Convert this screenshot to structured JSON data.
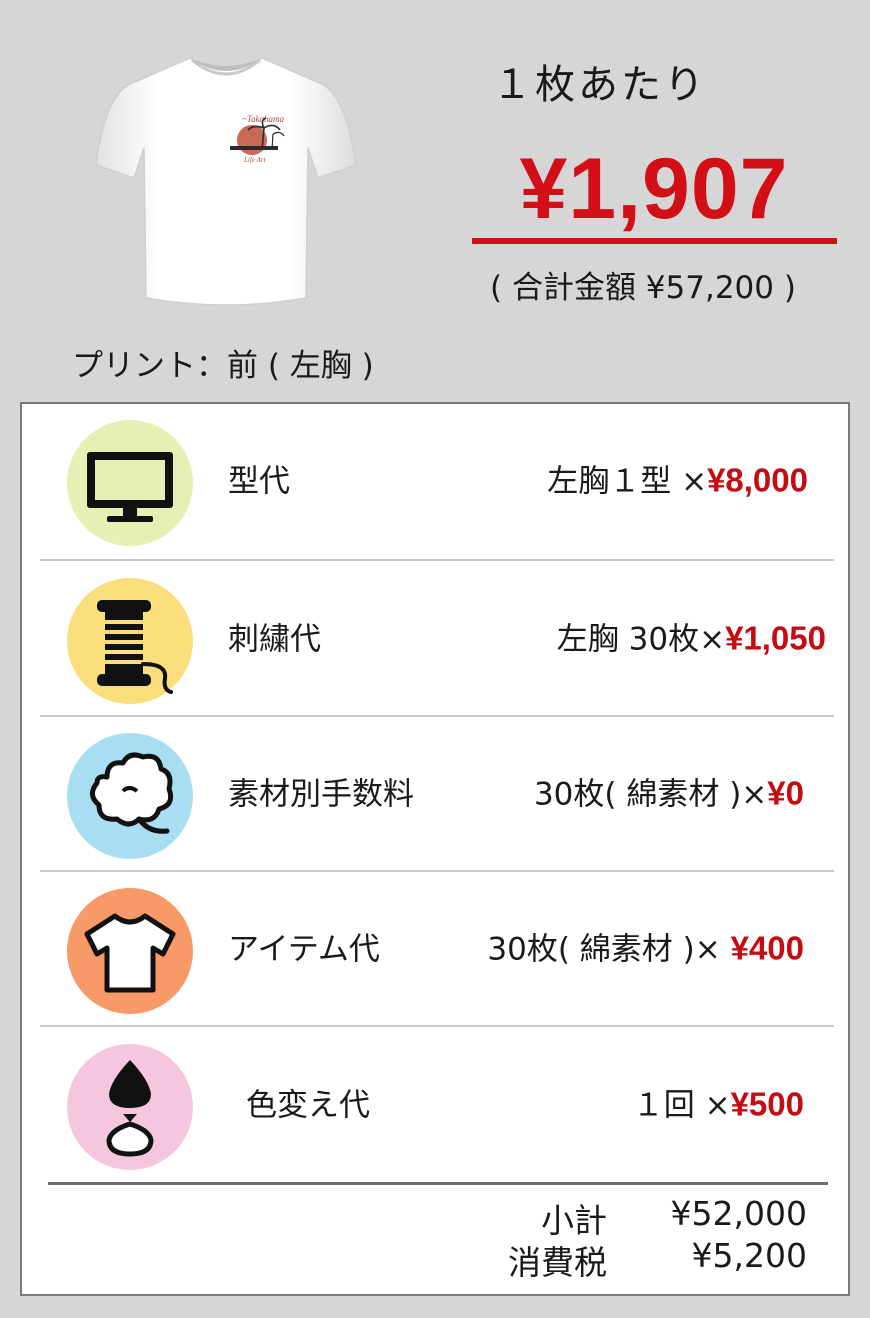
{
  "header": {
    "per_unit_label": "１枚あたり",
    "unit_price": "¥1,907",
    "total_text": "( 合計金額 ¥57,200 )",
    "print_location": "プリント：前 ( 左胸 )"
  },
  "items": [
    {
      "icon": "monitor-icon",
      "label": "型代",
      "detail": "左胸１型 ×",
      "amount": "¥8,000",
      "circle_color": "#e4f0b4"
    },
    {
      "icon": "thread-spool-icon",
      "label": "刺繍代",
      "detail": "左胸 30枚×",
      "amount": "¥1,050",
      "circle_color": "#fbde7c"
    },
    {
      "icon": "cotton-icon",
      "label": "素材別手数料",
      "detail": "30枚( 綿素材 )×",
      "amount": "¥0",
      "circle_color": "#a9def2"
    },
    {
      "icon": "tshirt-icon",
      "label": "アイテム代",
      "detail": "30枚( 綿素材 )× ",
      "amount": "¥400",
      "circle_color": "#f79a68"
    },
    {
      "icon": "ink-drop-icon",
      "label": "色変え代",
      "detail": "１回 ×",
      "amount": "¥500",
      "circle_color": "#f6c6df"
    }
  ],
  "summary": {
    "subtotal_label": "小計",
    "subtotal_value": "¥52,000",
    "tax_label": "消費税",
    "tax_value": "¥5,200"
  },
  "colors": {
    "accent_red": "#d20f16",
    "background": "#d6d6d6",
    "panel": "#ffffff"
  }
}
